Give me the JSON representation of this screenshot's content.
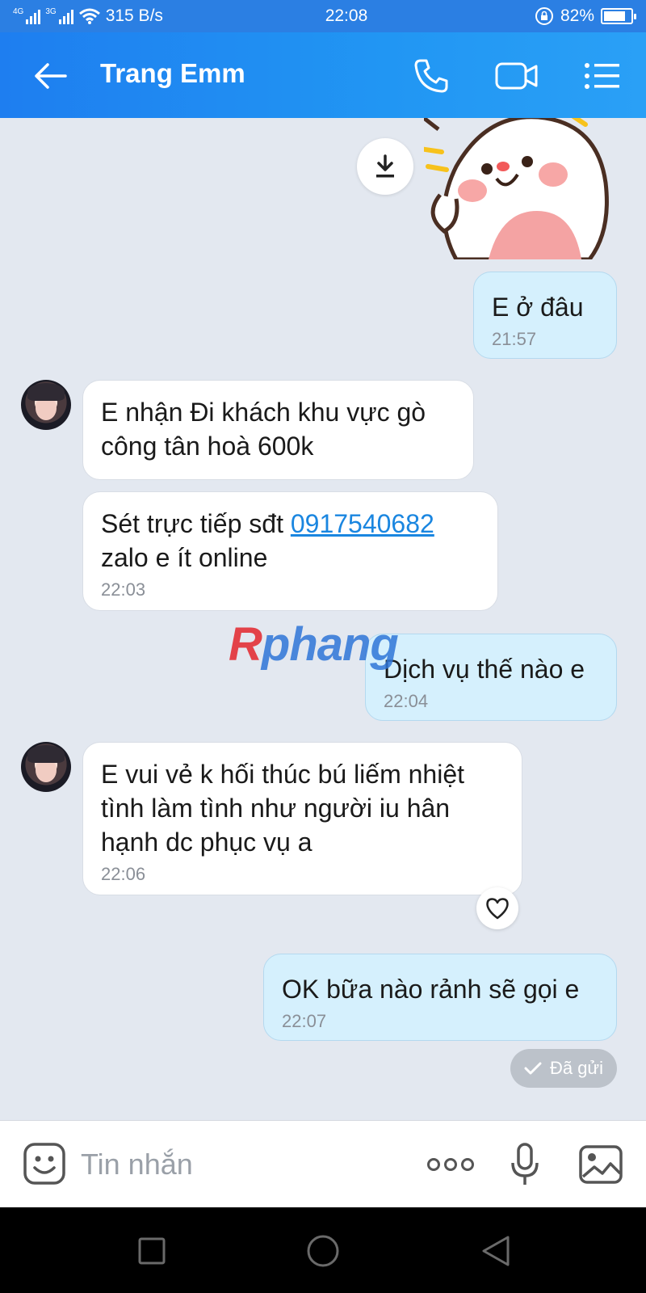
{
  "status_bar": {
    "network_1": "4G",
    "network_2": "3G",
    "speed": "315 B/s",
    "time": "22:08",
    "battery": "82%",
    "battery_level": 0.82
  },
  "header": {
    "title": "Trang Emm",
    "back_icon": "arrow-left-icon",
    "call_icon": "phone-icon",
    "video_icon": "video-camera-icon",
    "menu_icon": "list-menu-icon",
    "color": "#2196f3"
  },
  "messages": [
    {
      "direction": "out",
      "text": "E ở đâu",
      "time": "21:57"
    },
    {
      "direction": "in",
      "text": "E nhận Đi khách khu vực gò công tân hoà 600k",
      "time": ""
    },
    {
      "direction": "in",
      "text_before": "Sét trực tiếp sđt ",
      "phone": "0917540682",
      "text_after": "zalo e ít online",
      "time": "22:03"
    },
    {
      "direction": "out",
      "text": "Dịch vụ thế nào e",
      "time": "22:04"
    },
    {
      "direction": "in",
      "text": "E vui vẻ k hối thúc bú liếm nhiệt tình làm tình như người iu hân hạnh dc phục vụ a",
      "time": "22:06"
    },
    {
      "direction": "out",
      "text": "OK bữa nào rảnh sẽ gọi e",
      "time": "22:07"
    }
  ],
  "sent_status": "Đã gửi",
  "watermark": {
    "first": "R",
    "rest": "phang"
  },
  "input": {
    "placeholder": "Tin nhắn",
    "emoji_icon": "sticker-emoji-icon",
    "more_icon": "more-dots-icon",
    "mic_icon": "microphone-icon",
    "image_icon": "image-gallery-icon"
  },
  "colors": {
    "incoming_bubble": "#ffffff",
    "outgoing_bubble": "#d5f0fd",
    "chat_background": "#e3e8f0",
    "link": "#1a86e0"
  }
}
